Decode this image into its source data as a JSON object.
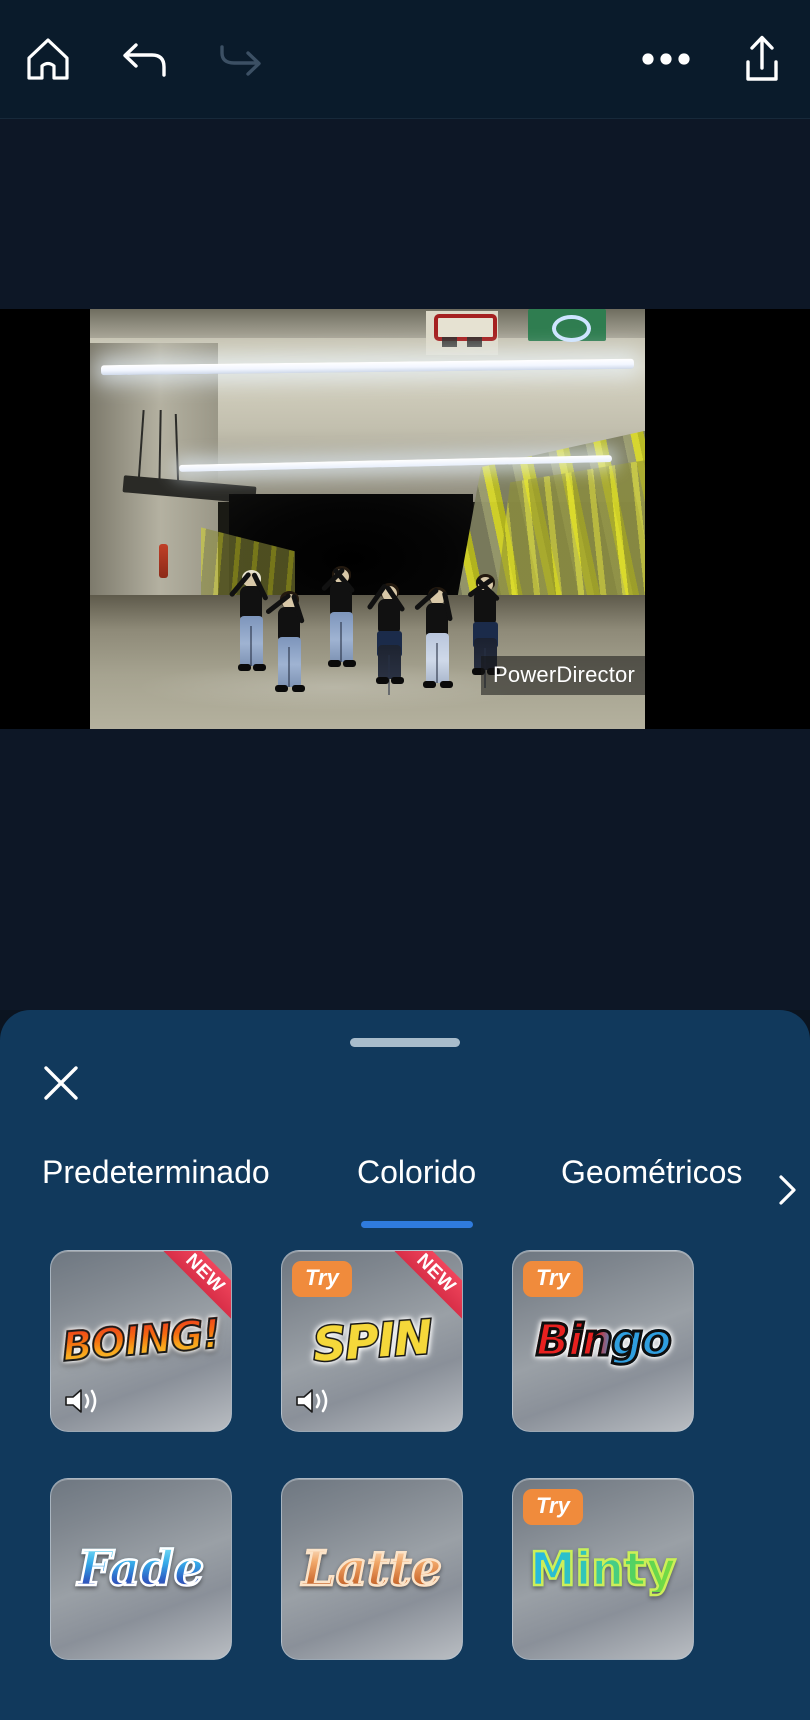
{
  "topbar": {
    "background": "#0a1b2b",
    "buttons": [
      {
        "name": "home-icon",
        "label": "Home",
        "state": "enabled"
      },
      {
        "name": "undo-icon",
        "label": "Undo",
        "state": "enabled"
      },
      {
        "name": "redo-icon",
        "label": "Redo",
        "state": "disabled"
      },
      {
        "name": "more-icon",
        "label": "More",
        "state": "enabled"
      },
      {
        "name": "export-icon",
        "label": "Export",
        "state": "enabled"
      }
    ]
  },
  "preview": {
    "watermark": "PowerDirector",
    "scene_description": "Dancers in a lit underpass corridor with yellow railings"
  },
  "sheet": {
    "background": "#11395c",
    "close_label": "Close",
    "grab_handle": "drag-handle",
    "scroll_next_label": "›",
    "tabs": [
      {
        "label": "Predeterminado",
        "active": false
      },
      {
        "label": "Colorido",
        "active": true
      },
      {
        "label": "Geométricos",
        "active": false
      }
    ],
    "active_tab_color": "#2f7bdd",
    "badges": {
      "try": "Try",
      "new": "NEW"
    },
    "effects": [
      {
        "title": "BOING!",
        "badge_try": false,
        "badge_new": true,
        "has_audio": true,
        "style": "lbl-boing"
      },
      {
        "title": "SPIN",
        "badge_try": true,
        "badge_new": true,
        "has_audio": true,
        "style": "lbl-spin"
      },
      {
        "title": "Bingo",
        "badge_try": true,
        "badge_new": false,
        "has_audio": false,
        "style": "lbl-bingo"
      },
      {
        "title": "Fade",
        "badge_try": false,
        "badge_new": false,
        "has_audio": false,
        "style": "lbl-fade"
      },
      {
        "title": "Latte",
        "badge_try": false,
        "badge_new": false,
        "has_audio": false,
        "style": "lbl-latte"
      },
      {
        "title": "Minty",
        "badge_try": true,
        "badge_new": false,
        "has_audio": false,
        "style": "lbl-minty"
      }
    ]
  }
}
